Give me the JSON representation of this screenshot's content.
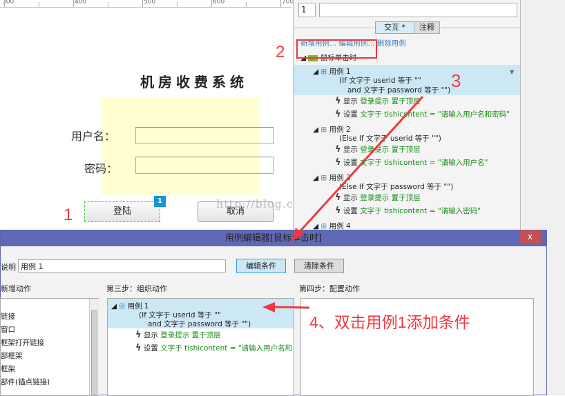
{
  "ruler": {
    "labels": [
      "300",
      "400",
      "500",
      "600",
      "700"
    ]
  },
  "canvas": {
    "title": "机房收费系统",
    "username_label": "用户名：",
    "password_label": "密码：",
    "login_button": "登陆",
    "cancel_button": "取消",
    "badge": "1",
    "watermark": "http://blog.csdn.net/"
  },
  "panel": {
    "page_num": "1",
    "name_value": "",
    "tabs": [
      "交互 *",
      "注释"
    ],
    "links": [
      "新增用例...",
      "编辑用例...",
      "删除用例"
    ],
    "event": "鼠标单击时",
    "cases": [
      {
        "title": "用例 1",
        "cond": [
          "(If 文字于 userid 等于 \"\"",
          "and 文字于 password 等于 \"\")"
        ],
        "actions": [
          {
            "verb": "显示",
            "detail": "登录提示 置于顶层"
          },
          {
            "verb": "设置",
            "detail": "文字于 tishicontent = \"请输入用户名和密码\""
          }
        ]
      },
      {
        "title": "用例 2",
        "cond": [
          "(Else If 文字于 userid 等于 \"\")"
        ],
        "actions": [
          {
            "verb": "显示",
            "detail": "登录提示 置于顶层"
          },
          {
            "verb": "设置",
            "detail": "文字于 tishicontent = \"请输入用户名\""
          }
        ]
      },
      {
        "title": "用例 3",
        "cond": [
          "(Else If 文字于 password 等于 \"\")"
        ],
        "actions": [
          {
            "verb": "显示",
            "detail": "登录提示 置于顶层"
          },
          {
            "verb": "设置",
            "detail": "文字于 tishicontent = \"请输入密码\""
          }
        ]
      },
      {
        "title": "用例 4",
        "cond": [],
        "actions": []
      }
    ]
  },
  "dialog": {
    "title": "用例编辑器[鼠标单击时]",
    "close": "x",
    "desc_label": "说明",
    "desc_value": "用例 1",
    "edit_cond": "编辑条件",
    "clear_cond": "清除条件",
    "col1": "新增动作",
    "col2": "第三步：组织动作",
    "col3": "第四步：配置动作",
    "actions_list": [
      "链接",
      "窗口",
      "框架打开链接",
      "部框架",
      "框架",
      "部件(锚点链接)"
    ],
    "case": {
      "title": "用例 1",
      "cond": [
        "(If 文字于 userid 等于 \"\"",
        "and 文字于 password 等于 \"\")"
      ],
      "a1_verb": "显示",
      "a1_detail": "登录提示 置于顶层",
      "a2_verb": "设置",
      "a2_detail": "文字于 tishicontent = \"请输入用户名和"
    }
  },
  "annotations": {
    "n1": "1",
    "n2": "2",
    "n3": "3",
    "n4": "4、双击用例1添加条件"
  },
  "colors": {
    "accent": "#6069b6",
    "selection": "#cde8f5",
    "annotation": "#f0393e",
    "action_green": "#1a8a1a"
  }
}
